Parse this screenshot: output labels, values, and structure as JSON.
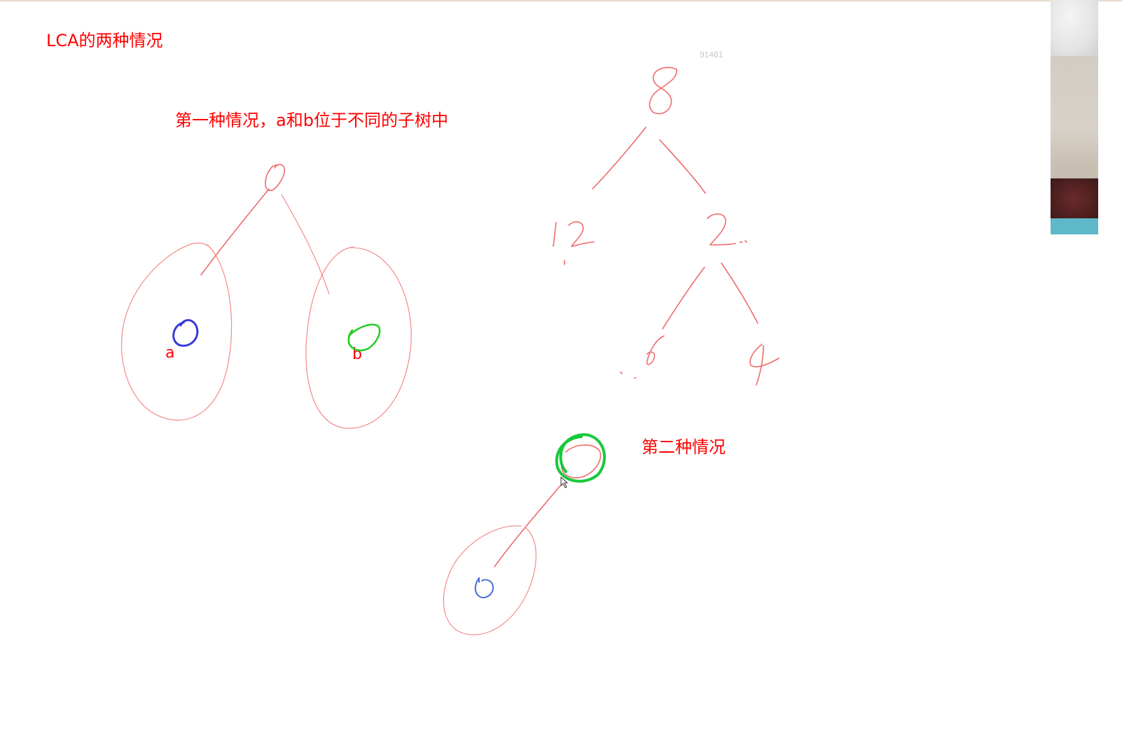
{
  "title": "LCA的两种情况",
  "case1": {
    "heading": "第一种情况，a和b位于不同的子树中",
    "label_a": "a",
    "label_b": "b"
  },
  "case2": {
    "heading": "第二种情况"
  },
  "watermark": "91461",
  "example_tree": {
    "root": "8",
    "left_child": "12",
    "right_child": "2",
    "right_left_child": "6",
    "right_right_child": "4"
  },
  "colors": {
    "text_red": "#ff0000",
    "ink_red": "#f06a6a",
    "ink_blue": "#3a3ad8",
    "ink_green": "#22cc22"
  }
}
